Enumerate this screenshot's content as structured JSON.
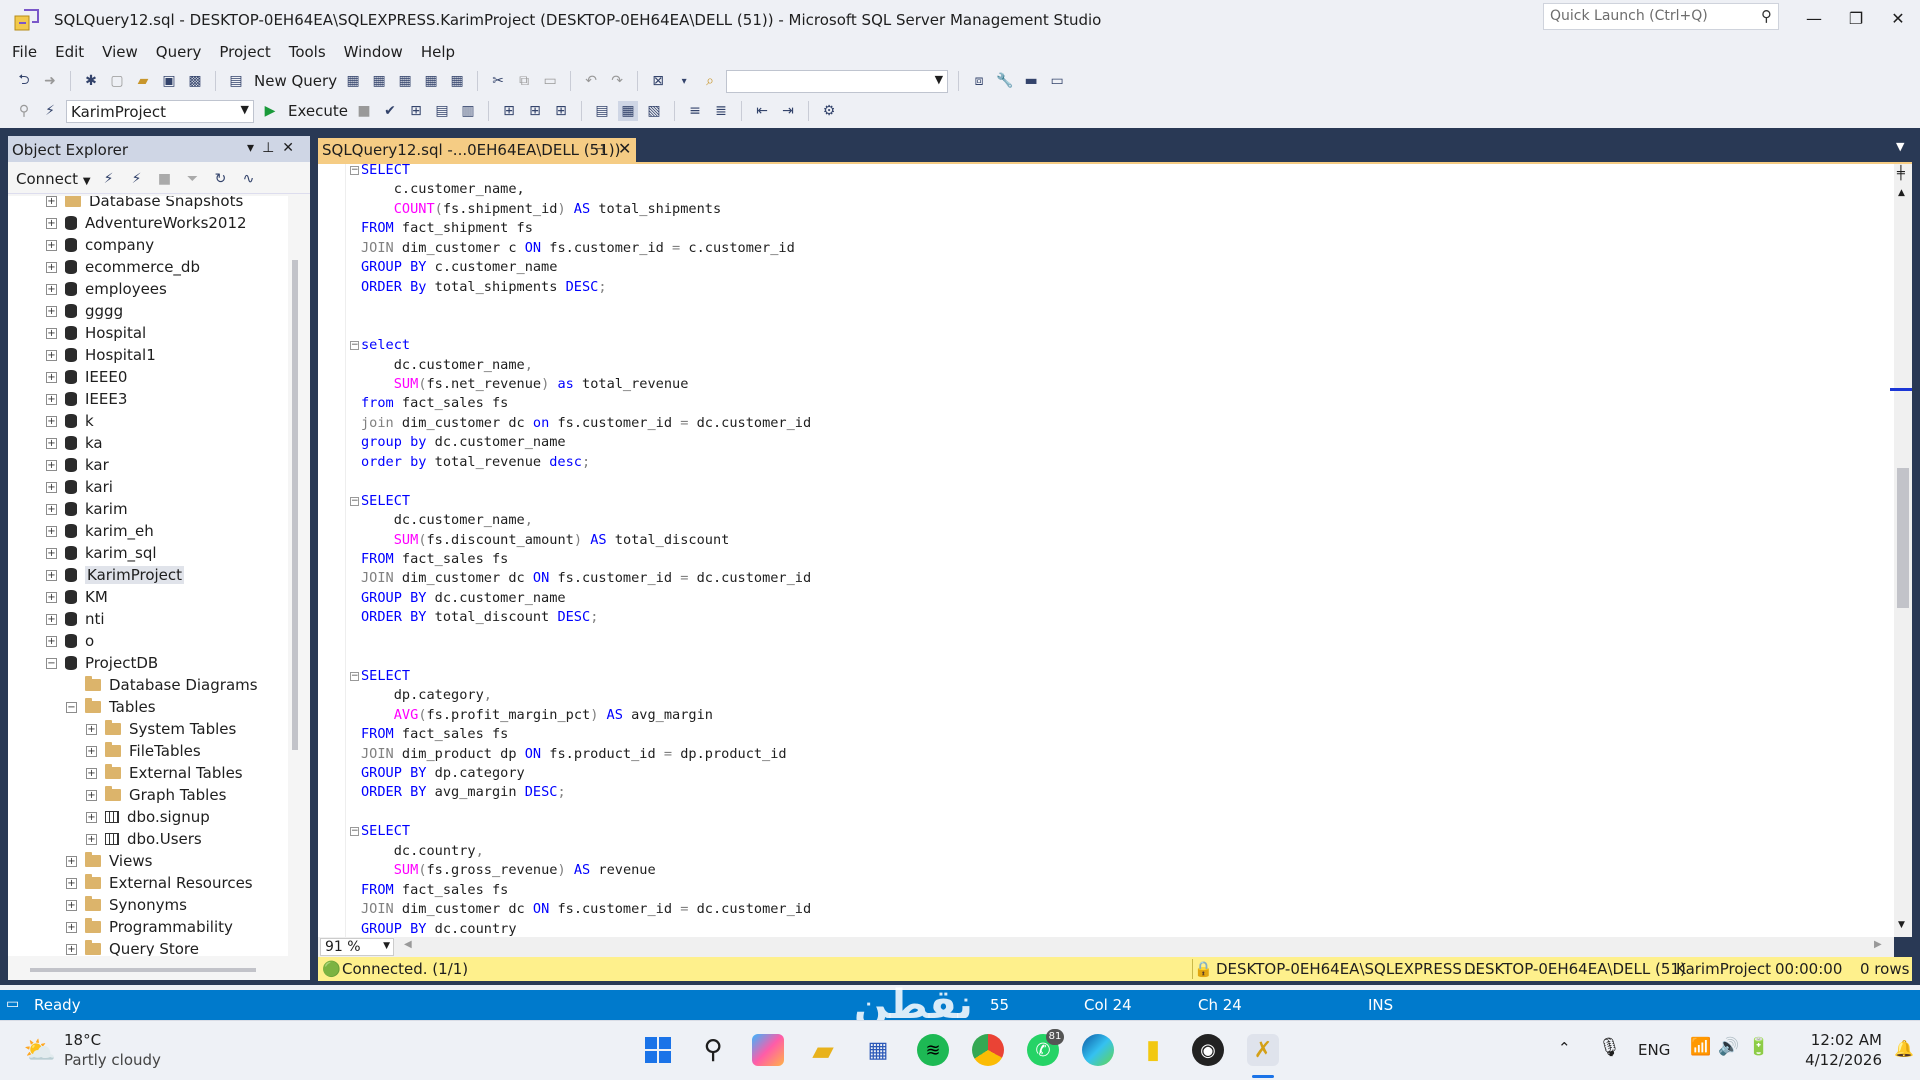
{
  "window": {
    "title": "SQLQuery12.sql - DESKTOP-0EH64EA\\SQLEXPRESS.KarimProject (DESKTOP-0EH64EA\\DELL (51)) - Microsoft SQL Server Management Studio",
    "quick_launch_placeholder": "Quick Launch (Ctrl+Q)",
    "minimize_glyph": "—",
    "restore_glyph": "❐",
    "close_glyph": "✕"
  },
  "menu": [
    "File",
    "Edit",
    "View",
    "Query",
    "Project",
    "Tools",
    "Window",
    "Help"
  ],
  "toolbar1": {
    "new_query_label": "New Query"
  },
  "toolbar2": {
    "database": "KarimProject",
    "execute_label": "Execute"
  },
  "object_explorer": {
    "title": "Object Explorer",
    "connect_label": "Connect",
    "tree": [
      {
        "label": "Database Snapshots",
        "icon": "folder-icon",
        "expander": "+",
        "level": 0
      },
      {
        "label": "AdventureWorks2012",
        "icon": "database-icon",
        "expander": "+",
        "level": 0
      },
      {
        "label": "company",
        "icon": "database-icon",
        "expander": "+",
        "level": 0
      },
      {
        "label": "ecommerce_db",
        "icon": "database-icon",
        "expander": "+",
        "level": 0
      },
      {
        "label": "employees",
        "icon": "database-icon",
        "expander": "+",
        "level": 0
      },
      {
        "label": "gggg",
        "icon": "database-icon",
        "expander": "+",
        "level": 0
      },
      {
        "label": "Hospital",
        "icon": "database-icon",
        "expander": "+",
        "level": 0
      },
      {
        "label": "Hospital1",
        "icon": "database-icon",
        "expander": "+",
        "level": 0
      },
      {
        "label": "IEEE0",
        "icon": "database-icon",
        "expander": "+",
        "level": 0
      },
      {
        "label": "IEEE3",
        "icon": "database-icon",
        "expander": "+",
        "level": 0
      },
      {
        "label": "k",
        "icon": "database-icon",
        "expander": "+",
        "level": 0
      },
      {
        "label": "ka",
        "icon": "database-icon",
        "expander": "+",
        "level": 0
      },
      {
        "label": "kar",
        "icon": "database-icon",
        "expander": "+",
        "level": 0
      },
      {
        "label": "kari",
        "icon": "database-icon",
        "expander": "+",
        "level": 0
      },
      {
        "label": "karim",
        "icon": "database-icon",
        "expander": "+",
        "level": 0
      },
      {
        "label": "karim_eh",
        "icon": "database-icon",
        "expander": "+",
        "level": 0
      },
      {
        "label": "karim_sql",
        "icon": "database-icon",
        "expander": "+",
        "level": 0
      },
      {
        "label": "KarimProject",
        "icon": "database-icon",
        "expander": "+",
        "level": 0,
        "selected": true
      },
      {
        "label": "KM",
        "icon": "database-icon",
        "expander": "+",
        "level": 0
      },
      {
        "label": "nti",
        "icon": "database-icon",
        "expander": "+",
        "level": 0
      },
      {
        "label": "o",
        "icon": "database-icon",
        "expander": "+",
        "level": 0
      },
      {
        "label": "ProjectDB",
        "icon": "database-icon",
        "expander": "−",
        "level": 0
      },
      {
        "label": "Database Diagrams",
        "icon": "folder-icon",
        "expander": "",
        "level": 1
      },
      {
        "label": "Tables",
        "icon": "folder-icon",
        "expander": "−",
        "level": 1
      },
      {
        "label": "System Tables",
        "icon": "folder-icon",
        "expander": "+",
        "level": 2
      },
      {
        "label": "FileTables",
        "icon": "folder-icon",
        "expander": "+",
        "level": 2
      },
      {
        "label": "External Tables",
        "icon": "folder-icon",
        "expander": "+",
        "level": 2
      },
      {
        "label": "Graph Tables",
        "icon": "folder-icon",
        "expander": "+",
        "level": 2
      },
      {
        "label": "dbo.signup",
        "icon": "table-icon",
        "expander": "+",
        "level": 2
      },
      {
        "label": "dbo.Users",
        "icon": "table-icon",
        "expander": "+",
        "level": 2
      },
      {
        "label": "Views",
        "icon": "folder-icon",
        "expander": "+",
        "level": 1
      },
      {
        "label": "External Resources",
        "icon": "folder-icon",
        "expander": "+",
        "level": 1
      },
      {
        "label": "Synonyms",
        "icon": "folder-icon",
        "expander": "+",
        "level": 1
      },
      {
        "label": "Programmability",
        "icon": "folder-icon",
        "expander": "+",
        "level": 1
      },
      {
        "label": "Query Store",
        "icon": "folder-icon",
        "expander": "+",
        "level": 1
      }
    ]
  },
  "editor": {
    "tab_label": "SQLQuery12.sql -...0EH64EA\\DELL (51))",
    "zoom": "91 %",
    "lines": [
      {
        "fold": true,
        "parts": [
          [
            "kw",
            "SELECT"
          ]
        ]
      },
      {
        "parts": [
          [
            "",
            "    c.customer_name,"
          ]
        ]
      },
      {
        "parts": [
          [
            "",
            "    "
          ],
          [
            "fn",
            "COUNT"
          ],
          [
            "gr",
            "("
          ],
          [
            "",
            "fs.shipment_id"
          ],
          [
            "gr",
            ")"
          ],
          [
            "",
            ""
          ],
          [
            "kw",
            " AS"
          ],
          [
            "",
            " total_shipments"
          ]
        ]
      },
      {
        "parts": [
          [
            "kw",
            "FROM"
          ],
          [
            "",
            " fact_shipment fs"
          ]
        ]
      },
      {
        "parts": [
          [
            "gr",
            "JOIN"
          ],
          [
            "",
            " dim_customer c "
          ],
          [
            "kw",
            "ON"
          ],
          [
            "",
            " fs.customer_id "
          ],
          [
            "gr",
            "="
          ],
          [
            "",
            " c.customer_id"
          ]
        ]
      },
      {
        "parts": [
          [
            "kw",
            "GROUP BY"
          ],
          [
            "",
            " c.customer_name"
          ]
        ]
      },
      {
        "parts": [
          [
            "kw",
            "ORDER By"
          ],
          [
            "",
            " total_shipments "
          ],
          [
            "kw",
            "DESC"
          ],
          [
            "gr",
            ";"
          ]
        ]
      },
      {
        "parts": []
      },
      {
        "parts": []
      },
      {
        "fold": true,
        "parts": [
          [
            "kw",
            "select"
          ]
        ]
      },
      {
        "parts": [
          [
            "",
            "    dc.customer_name"
          ],
          [
            "gr",
            ","
          ]
        ]
      },
      {
        "parts": [
          [
            "",
            "    "
          ],
          [
            "fn",
            "SUM"
          ],
          [
            "gr",
            "("
          ],
          [
            "",
            "fs.net_revenue"
          ],
          [
            "gr",
            ")"
          ],
          [
            "kw",
            " as"
          ],
          [
            "",
            " total_revenue"
          ]
        ]
      },
      {
        "parts": [
          [
            "kw",
            "from"
          ],
          [
            "",
            " fact_sales fs"
          ]
        ]
      },
      {
        "parts": [
          [
            "gr",
            "join"
          ],
          [
            "",
            " dim_customer dc "
          ],
          [
            "kw",
            "on"
          ],
          [
            "",
            " fs.customer_id "
          ],
          [
            "gr",
            "="
          ],
          [
            "",
            " dc.customer_id"
          ]
        ]
      },
      {
        "parts": [
          [
            "kw",
            "group by"
          ],
          [
            "",
            " dc.customer_name"
          ]
        ]
      },
      {
        "parts": [
          [
            "kw",
            "order by"
          ],
          [
            "",
            " total_revenue "
          ],
          [
            "kw",
            "desc"
          ],
          [
            "gr",
            ";"
          ]
        ]
      },
      {
        "parts": []
      },
      {
        "fold": true,
        "parts": [
          [
            "kw",
            "SELECT"
          ]
        ]
      },
      {
        "parts": [
          [
            "",
            "    dc.customer_name"
          ],
          [
            "gr",
            ","
          ]
        ]
      },
      {
        "parts": [
          [
            "",
            "    "
          ],
          [
            "fn",
            "SUM"
          ],
          [
            "gr",
            "("
          ],
          [
            "",
            "fs.discount_amount"
          ],
          [
            "gr",
            ")"
          ],
          [
            "kw",
            " AS"
          ],
          [
            "",
            " total_discount"
          ]
        ]
      },
      {
        "parts": [
          [
            "kw",
            "FROM"
          ],
          [
            "",
            " fact_sales fs"
          ]
        ]
      },
      {
        "parts": [
          [
            "gr",
            "JOIN"
          ],
          [
            "",
            " dim_customer dc "
          ],
          [
            "kw",
            "ON"
          ],
          [
            "",
            " fs.customer_id "
          ],
          [
            "gr",
            "="
          ],
          [
            "",
            " dc.customer_id"
          ]
        ]
      },
      {
        "parts": [
          [
            "kw",
            "GROUP BY"
          ],
          [
            "",
            " dc.customer_name"
          ]
        ]
      },
      {
        "parts": [
          [
            "kw",
            "ORDER BY"
          ],
          [
            "",
            " total_discount "
          ],
          [
            "kw",
            "DESC"
          ],
          [
            "gr",
            ";"
          ]
        ]
      },
      {
        "parts": []
      },
      {
        "parts": []
      },
      {
        "fold": true,
        "parts": [
          [
            "kw",
            "SELECT"
          ]
        ]
      },
      {
        "parts": [
          [
            "",
            "    dp.category"
          ],
          [
            "gr",
            ","
          ]
        ]
      },
      {
        "parts": [
          [
            "",
            "    "
          ],
          [
            "fn",
            "AVG"
          ],
          [
            "gr",
            "("
          ],
          [
            "",
            "fs.profit_margin_pct"
          ],
          [
            "gr",
            ")"
          ],
          [
            "kw",
            " AS"
          ],
          [
            "",
            " avg_margin"
          ]
        ]
      },
      {
        "parts": [
          [
            "kw",
            "FROM"
          ],
          [
            "",
            " fact_sales fs"
          ]
        ]
      },
      {
        "parts": [
          [
            "gr",
            "JOIN"
          ],
          [
            "",
            " dim_product dp "
          ],
          [
            "kw",
            "ON"
          ],
          [
            "",
            " fs.product_id "
          ],
          [
            "gr",
            "="
          ],
          [
            "",
            " dp.product_id"
          ]
        ]
      },
      {
        "parts": [
          [
            "kw",
            "GROUP BY"
          ],
          [
            "",
            " dp.category"
          ]
        ]
      },
      {
        "parts": [
          [
            "kw",
            "ORDER BY"
          ],
          [
            "",
            " avg_margin "
          ],
          [
            "kw",
            "DESC"
          ],
          [
            "gr",
            ";"
          ]
        ]
      },
      {
        "parts": []
      },
      {
        "fold": true,
        "parts": [
          [
            "kw",
            "SELECT"
          ]
        ]
      },
      {
        "parts": [
          [
            "",
            "    dc.country"
          ],
          [
            "gr",
            ","
          ]
        ]
      },
      {
        "parts": [
          [
            "",
            "    "
          ],
          [
            "fn",
            "SUM"
          ],
          [
            "gr",
            "("
          ],
          [
            "",
            "fs.gross_revenue"
          ],
          [
            "gr",
            ")"
          ],
          [
            "kw",
            " AS"
          ],
          [
            "",
            " revenue"
          ]
        ]
      },
      {
        "parts": [
          [
            "kw",
            "FROM"
          ],
          [
            "",
            " fact_sales fs"
          ]
        ]
      },
      {
        "parts": [
          [
            "gr",
            "JOIN"
          ],
          [
            "",
            " dim_customer dc "
          ],
          [
            "kw",
            "ON"
          ],
          [
            "",
            " fs.customer_id "
          ],
          [
            "gr",
            "="
          ],
          [
            "",
            " dc.customer_id"
          ]
        ]
      },
      {
        "parts": [
          [
            "kw",
            "GROUP BY"
          ],
          [
            "",
            " dc.country"
          ]
        ]
      }
    ]
  },
  "connection_strip": {
    "status": "Connected. (1/1)",
    "server": "DESKTOP-0EH64EA\\SQLEXPRESS ...",
    "user": "DESKTOP-0EH64EA\\DELL (51)",
    "database": "KarimProject",
    "elapsed": "00:00:00",
    "rows": "0 rows"
  },
  "statusbar": {
    "ready": "Ready",
    "ln": "55",
    "col": "Col 24",
    "ch": "Ch 24",
    "ins": "INS",
    "watermark": "نقطن"
  },
  "taskbar": {
    "weather_temp": "18°C",
    "weather_desc": "Partly cloudy",
    "lang": "ENG",
    "time": "12:02 AM",
    "date": "4/12/2026",
    "whatsapp_badge": "81"
  },
  "colors": {
    "accent_blue": "#007acc",
    "navy": "#293955",
    "tab_active": "#f5cc84",
    "connection_yellow": "#fef08c",
    "keyword": "#0000ff",
    "function": "#ff00ff",
    "operator": "#808080"
  }
}
